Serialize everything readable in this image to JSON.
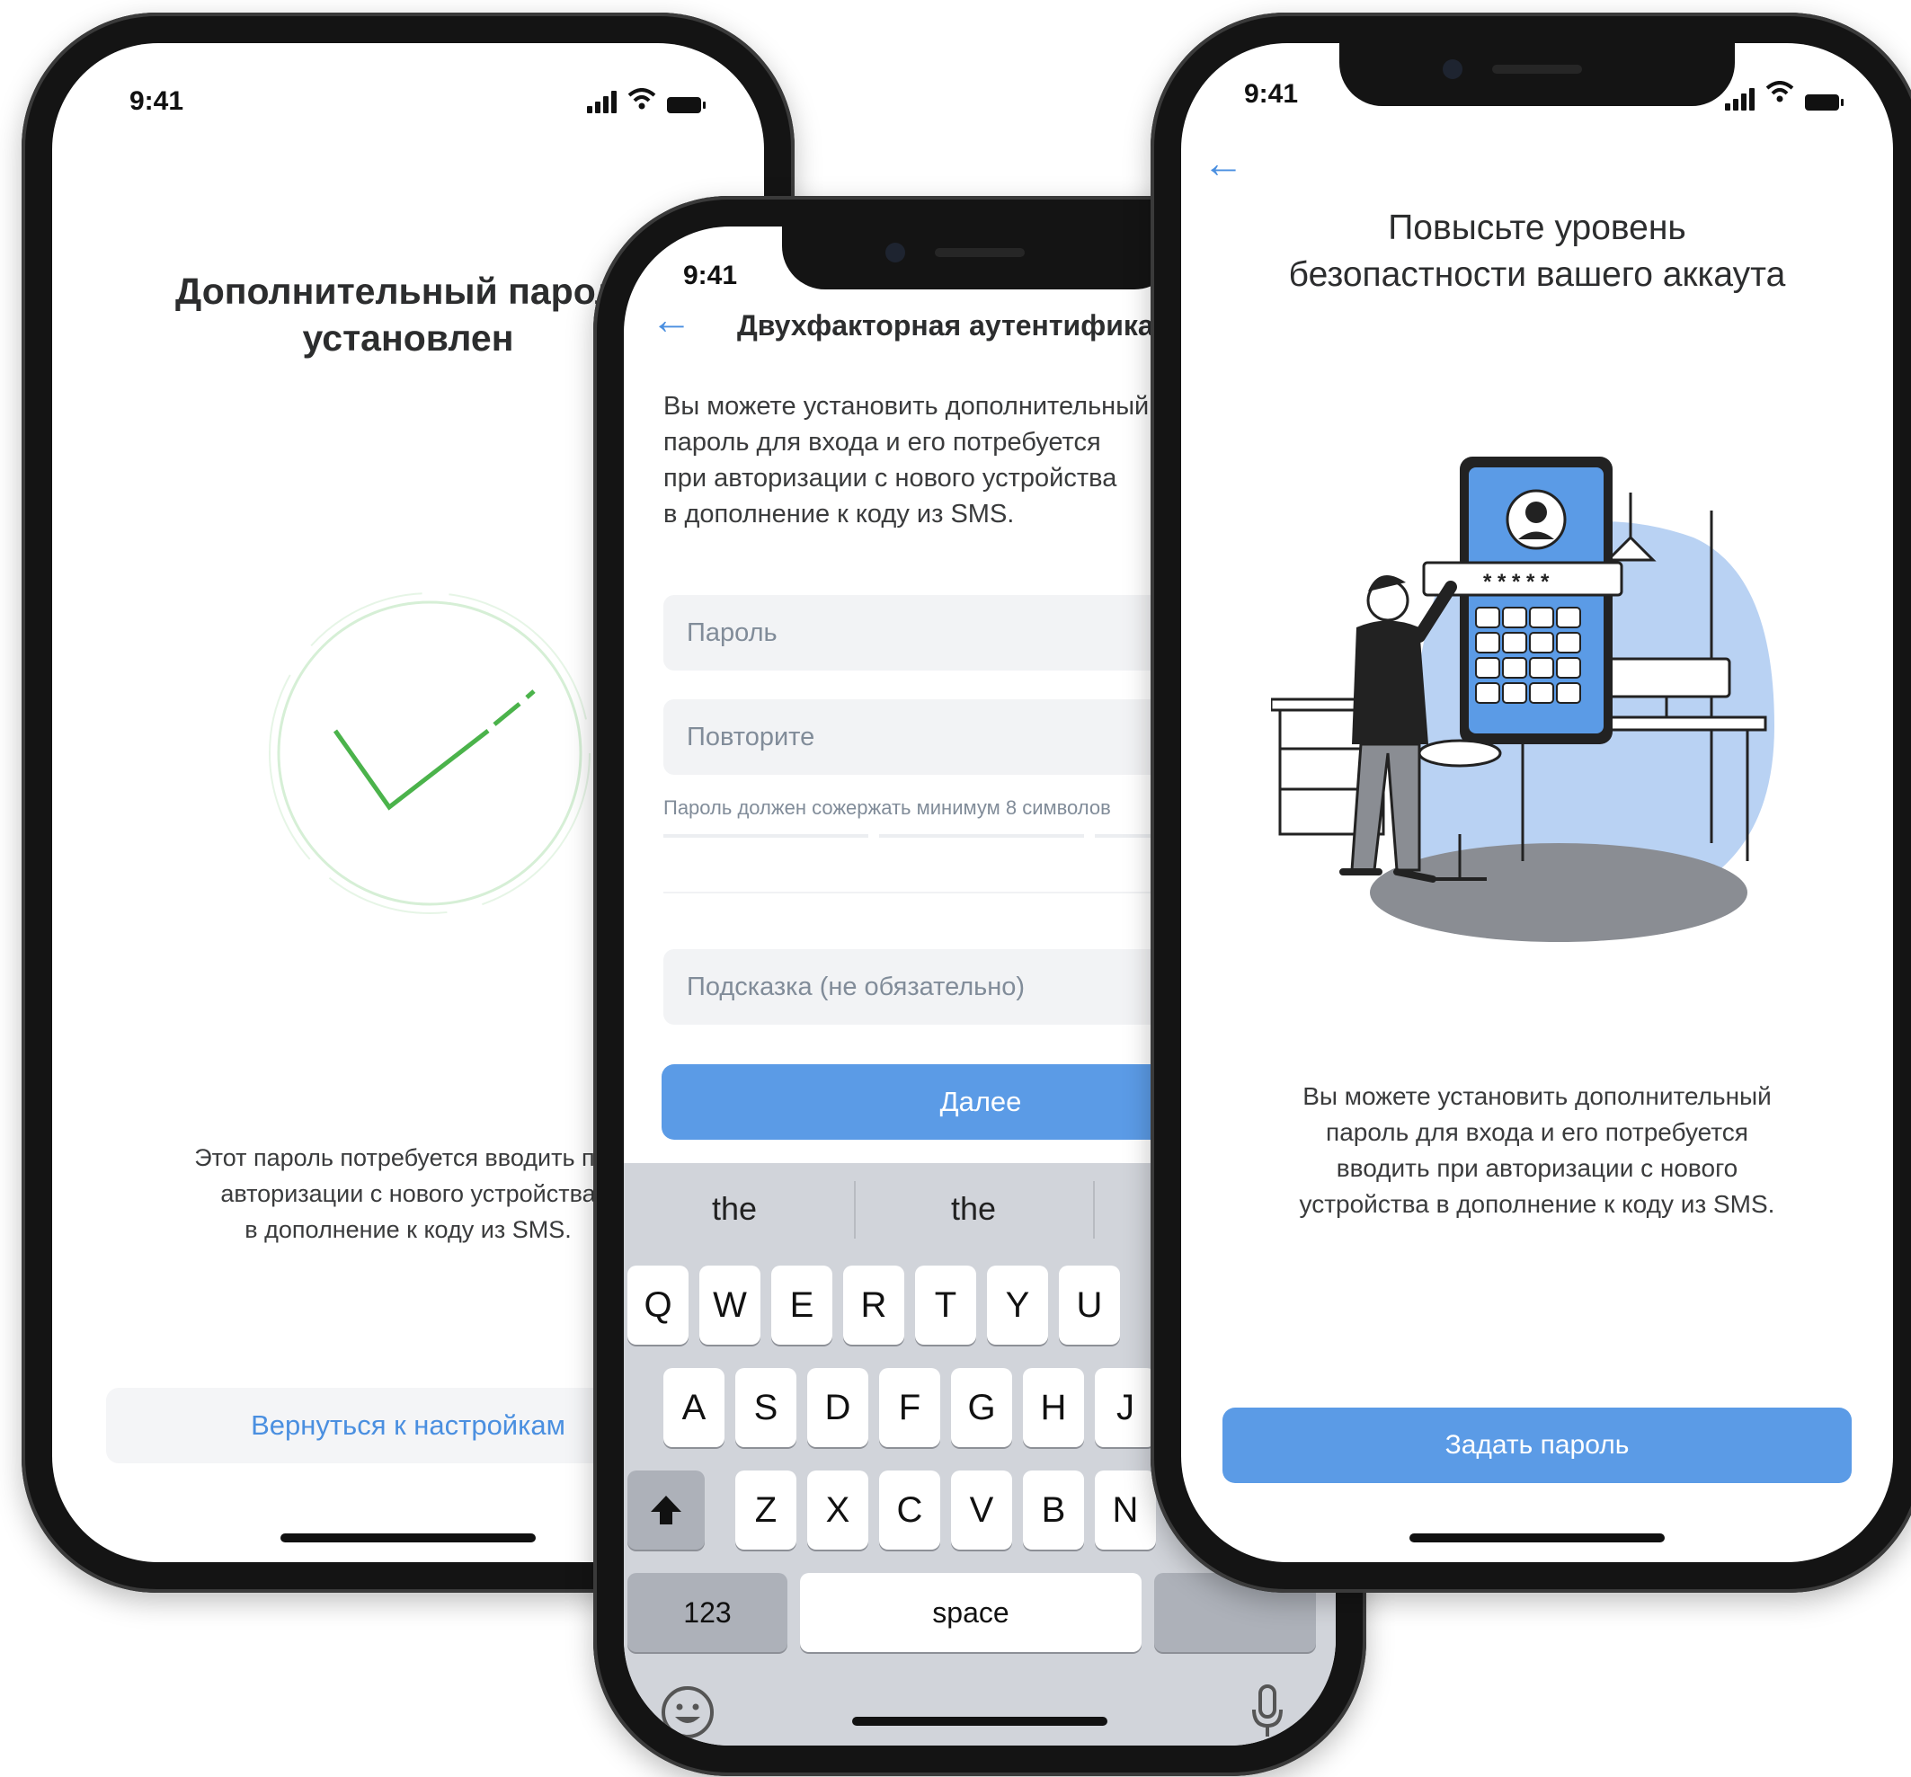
{
  "status": {
    "time": "9:41"
  },
  "screen_success": {
    "title_line1": "Дополнительный пароль",
    "title_line2": "установлен",
    "body_line1": "Этот пароль потребуется вводить при",
    "body_line2": "авторизации с нового устройства",
    "body_line3": "в дополнение к коду из SMS.",
    "back_button": "Вернуться к настройкам",
    "accent_color": "#4bb34b"
  },
  "screen_setup": {
    "header_title": "Двухфакторная аутентификация",
    "description_line1": "Вы можете установить дополнительный",
    "description_line2": "пароль для входа и его потребуется",
    "description_line3": "при авторизации с нового устройства",
    "description_line4": "в дополнение к коду из SMS.",
    "password_placeholder": "Пароль",
    "repeat_placeholder": "Повторите",
    "hint_text": "Пароль должен сожержать минимум 8 символов",
    "hint_placeholder": "Подсказка (не обязательно)",
    "next_button": "Далее",
    "keyboard": {
      "suggestions": [
        "the",
        "the"
      ],
      "row1": [
        "Q",
        "W",
        "E",
        "R",
        "T",
        "Y",
        "U"
      ],
      "row2": [
        "A",
        "S",
        "D",
        "F",
        "G",
        "H",
        "J"
      ],
      "row3": [
        "Z",
        "X",
        "C",
        "V",
        "B",
        "N"
      ],
      "numbers_key": "123",
      "space_key": "space"
    }
  },
  "screen_intro": {
    "title_line1": "Повысьте уровень",
    "title_line2": "безопастности вашего аккаута",
    "body_line1": "Вы можете установить дополнительный",
    "body_line2": "пароль для входа и его потребуется",
    "body_line3": "вводить при авторизации с нового",
    "body_line4": "устройства в дополнение к коду из SMS.",
    "set_password_button": "Задать пароль",
    "illustration_password_mask": "* * * * *"
  }
}
